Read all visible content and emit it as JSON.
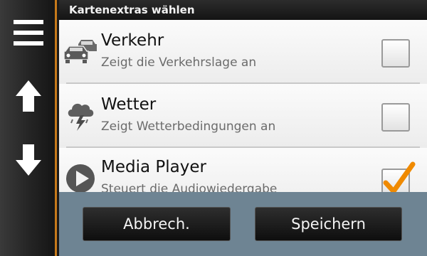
{
  "header": {
    "title": "Kartenextras wählen"
  },
  "rail": {
    "menu_icon": "hamburger-menu-icon",
    "up_icon": "arrow-up-icon",
    "down_icon": "arrow-down-icon"
  },
  "items": [
    {
      "title": "Verkehr",
      "subtitle": "Zeigt die Verkehrslage an",
      "icon": "traffic-cars-icon",
      "checked": false
    },
    {
      "title": "Wetter",
      "subtitle": "Zeigt Wetterbedingungen an",
      "icon": "thunderstorm-icon",
      "checked": false
    },
    {
      "title": "Media Player",
      "subtitle": "Steuert die Audiowiedergabe",
      "icon": "play-icon",
      "checked": true
    }
  ],
  "footer": {
    "cancel_label": "Abbrech.",
    "save_label": "Speichern"
  },
  "colors": {
    "accent": "#c77a1a",
    "checkmark": "#f08a00",
    "footer_bg": "#6e8493"
  }
}
